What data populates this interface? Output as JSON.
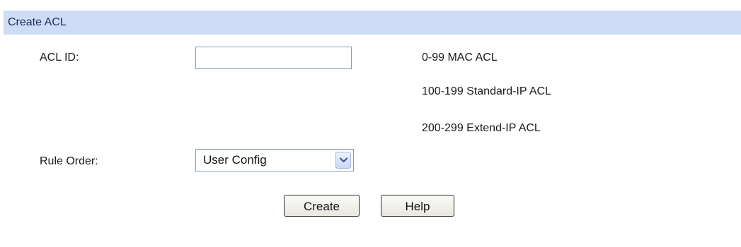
{
  "header": {
    "title": "Create ACL"
  },
  "form": {
    "acl_id": {
      "label": "ACL ID:",
      "value": "",
      "placeholder": ""
    },
    "ranges": [
      "0-99 MAC ACL",
      "100-199 Standard-IP ACL",
      "200-299 Extend-IP ACL"
    ],
    "rule_order": {
      "label": "Rule Order:",
      "selected": "User Config",
      "icon": "chevron-down-icon"
    }
  },
  "buttons": {
    "create": "Create",
    "help": "Help"
  },
  "colors": {
    "header_bg": "#cfdcf6",
    "input_border": "#7f9db9"
  }
}
